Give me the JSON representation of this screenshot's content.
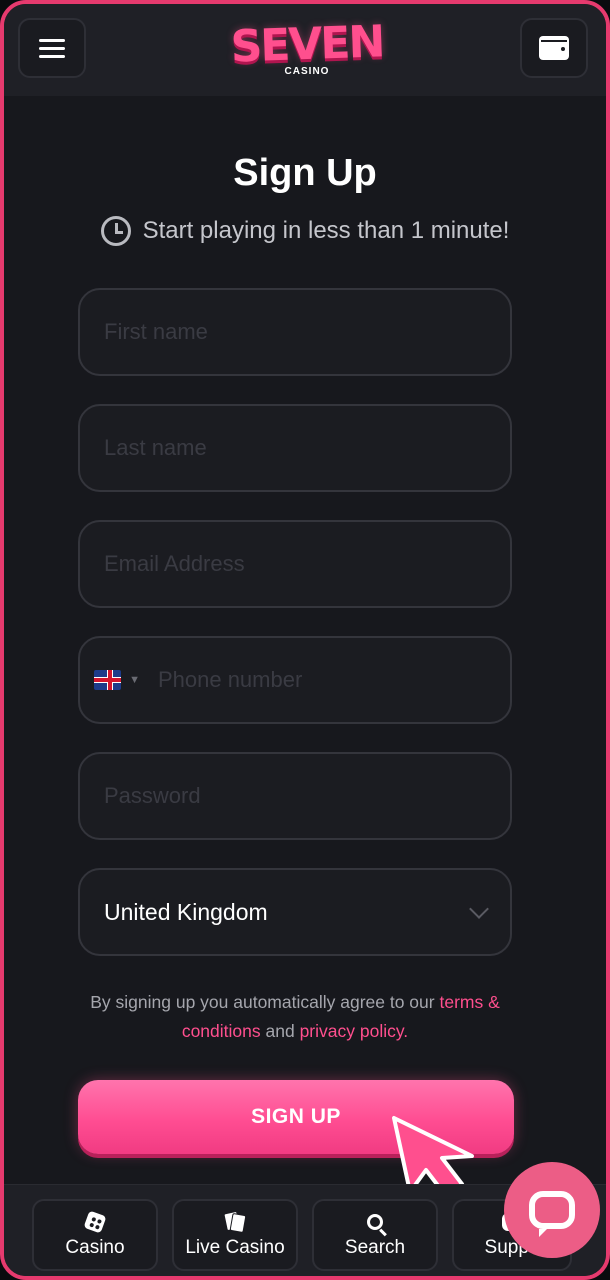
{
  "header": {
    "logo_text": "SEVEN",
    "logo_subtext": "CASINO",
    "menu_icon": "hamburger-menu-icon",
    "wallet_icon": "wallet-icon"
  },
  "page": {
    "title": "Sign Up",
    "subtitle": "Start playing in less than 1 minute!"
  },
  "form": {
    "first_name_placeholder": "First name",
    "last_name_placeholder": "Last name",
    "email_placeholder": "Email Address",
    "phone_placeholder": "Phone number",
    "phone_country_flag": "uk-flag-icon",
    "password_placeholder": "Password",
    "country_value": "United Kingdom"
  },
  "legal": {
    "prefix": "By signing up you automatically agree to our ",
    "terms_link": "terms & conditions",
    "middle": " and ",
    "privacy_link": "privacy policy."
  },
  "signup_button": "SIGN UP",
  "bottom_nav": {
    "items": [
      {
        "label": "Casino",
        "icon": "dice-icon"
      },
      {
        "label": "Live Casino",
        "icon": "cards-icon"
      },
      {
        "label": "Search",
        "icon": "search-icon"
      },
      {
        "label": "Suppo",
        "icon": "support-icon"
      }
    ]
  },
  "colors": {
    "accent": "#ff4f8e",
    "background": "#17181d",
    "frame": "#e63a6e"
  }
}
